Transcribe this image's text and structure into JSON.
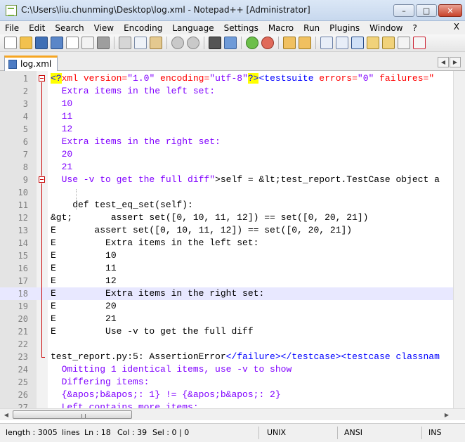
{
  "window": {
    "title": "C:\\Users\\liu.chunming\\Desktop\\log.xml - Notepad++ [Administrator]",
    "minimize_icon": "minimize-icon",
    "maximize_icon": "maximize-icon",
    "close_icon": "close-icon"
  },
  "menu": [
    "File",
    "Edit",
    "Search",
    "View",
    "Encoding",
    "Language",
    "Settings",
    "Macro",
    "Run",
    "Plugins",
    "Window",
    "?"
  ],
  "menu_close": "X",
  "tab": {
    "label": "log.xml"
  },
  "lines": [
    {
      "n": "1"
    },
    {
      "n": "2"
    },
    {
      "n": "3"
    },
    {
      "n": "4"
    },
    {
      "n": "5"
    },
    {
      "n": "6"
    },
    {
      "n": "7"
    },
    {
      "n": "8"
    },
    {
      "n": "9"
    },
    {
      "n": "10"
    },
    {
      "n": "11"
    },
    {
      "n": "12"
    },
    {
      "n": "13"
    },
    {
      "n": "14"
    },
    {
      "n": "15"
    },
    {
      "n": "16"
    },
    {
      "n": "17"
    },
    {
      "n": "18"
    },
    {
      "n": "19"
    },
    {
      "n": "20"
    },
    {
      "n": "21"
    },
    {
      "n": "22"
    },
    {
      "n": "23"
    },
    {
      "n": "24"
    },
    {
      "n": "25"
    },
    {
      "n": "26"
    },
    {
      "n": "27"
    }
  ],
  "code": {
    "l1_a": "<?",
    "l1_b": "xml version=",
    "l1_c": "\"1.0\"",
    "l1_d": " encoding=",
    "l1_e": "\"utf-8\"",
    "l1_f": "?>",
    "l1_g": "<testsuite",
    "l1_h": " errors=",
    "l1_i": "\"0\"",
    "l1_j": " failures=\"",
    "l2": "  Extra items in the left set:",
    "l3": "  10",
    "l4": "  11",
    "l5": "  12",
    "l6": "  Extra items in the right set:",
    "l7": "  20",
    "l8": "  21",
    "l9_a": "  Use -v to get the full diff\"",
    "l9_b": ">self = &lt;test_report.TestCase object a",
    "l10": "",
    "l11": "    def test_eq_set(self):",
    "l12": "&gt;       assert set([0, 10, 11, 12]) == set([0, 20, 21])",
    "l13": "E       assert set([0, 10, 11, 12]) == set([0, 20, 21])",
    "l14": "E         Extra items in the left set:",
    "l15": "E         10",
    "l16": "E         11",
    "l17": "E         12",
    "l18": "E         Extra items in the right set:",
    "l19": "E         20",
    "l20": "E         21",
    "l21": "E         Use -v to get the full diff",
    "l22": "",
    "l23_a": "test_report.py:5: AssertionError",
    "l23_b": "</failure></testcase><testcase classnam",
    "l24": "  Omitting 1 identical items, use -v to show",
    "l25": "  Differing items:",
    "l26": "  {&apos;b&apos;: 1} != {&apos;b&apos;: 2}",
    "l27": "  Left contains more items:"
  },
  "status": {
    "length": "length : 3005",
    "lines": "lines",
    "ln": "Ln : 18",
    "col": "Col : 39",
    "sel": "Sel : 0 | 0",
    "eol": "UNIX",
    "encoding": "ANSI",
    "mode": "INS"
  },
  "colors": {
    "keyword": "#0000ff",
    "attribute": "#ff0000",
    "value": "#8000ff",
    "current_line": "#e8e8ff",
    "fold_marker": "#c80000"
  }
}
